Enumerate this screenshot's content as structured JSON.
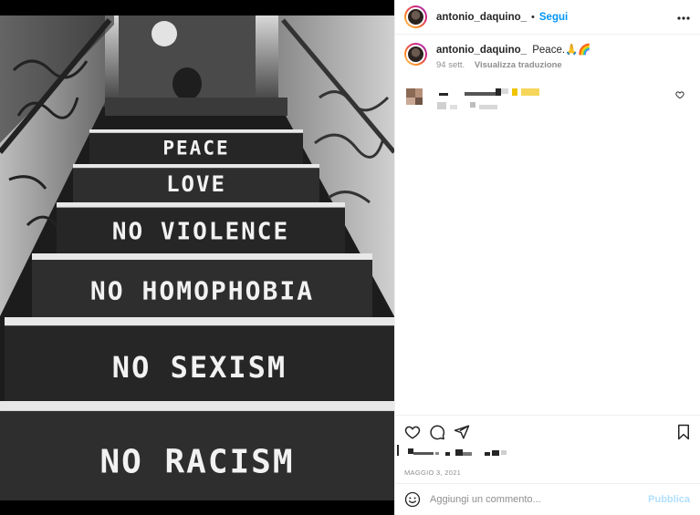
{
  "post": {
    "username": "antonio_daquino_",
    "separator": "•",
    "follow_label": "Segui",
    "more_label": "•••",
    "caption_text": "Peace.🙏🌈",
    "caption_age": "94 sett.",
    "translate_label": "Visualizza traduzione",
    "date": "MAGGIO 3, 2021"
  },
  "image": {
    "steps": [
      "PEACE",
      "LOVE",
      "NO  VIOLENCE",
      "NO  HOMOPHOBIA",
      "NO  SEXISM",
      "NO  RACISM"
    ]
  },
  "add_comment": {
    "placeholder": "Aggiungi un commento...",
    "publish_label": "Pubblica"
  },
  "icons": {
    "more": "more-icon",
    "like": "heart-icon",
    "comment": "comment-icon",
    "share": "share-icon",
    "save": "bookmark-icon",
    "emoji": "smiley-icon"
  }
}
